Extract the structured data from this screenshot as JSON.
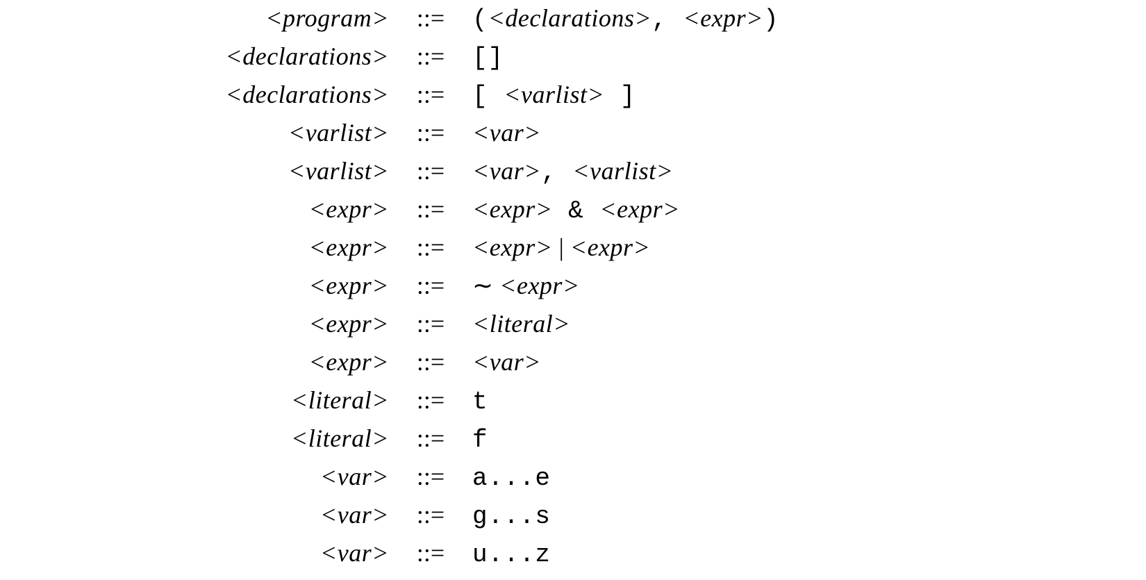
{
  "operator": "::=",
  "rules": [
    {
      "lhs": "<program>",
      "rhs": [
        {
          "type": "term",
          "text": "("
        },
        {
          "type": "nt",
          "text": "<declarations>"
        },
        {
          "type": "term",
          "text": ", "
        },
        {
          "type": "nt",
          "text": "<expr>"
        },
        {
          "type": "term",
          "text": ")"
        }
      ]
    },
    {
      "lhs": "<declarations>",
      "rhs": [
        {
          "type": "term",
          "text": "[]"
        }
      ]
    },
    {
      "lhs": "<declarations>",
      "rhs": [
        {
          "type": "term",
          "text": "[ "
        },
        {
          "type": "nt",
          "text": "<varlist>"
        },
        {
          "type": "term",
          "text": " ]"
        }
      ]
    },
    {
      "lhs": "<varlist>",
      "rhs": [
        {
          "type": "nt",
          "text": "<var>"
        }
      ]
    },
    {
      "lhs": "<varlist>",
      "rhs": [
        {
          "type": "nt",
          "text": "<var>"
        },
        {
          "type": "term",
          "text": ", "
        },
        {
          "type": "nt",
          "text": "<varlist>"
        }
      ]
    },
    {
      "lhs": "<expr>",
      "rhs": [
        {
          "type": "nt",
          "text": "<expr>"
        },
        {
          "type": "term",
          "text": " & "
        },
        {
          "type": "nt",
          "text": "<expr>"
        }
      ]
    },
    {
      "lhs": "<expr>",
      "rhs": [
        {
          "type": "nt",
          "text": "<expr>"
        },
        {
          "type": "sym",
          "text": " | "
        },
        {
          "type": "nt",
          "text": "<expr>"
        }
      ]
    },
    {
      "lhs": "<expr>",
      "rhs": [
        {
          "type": "sym",
          "text": "∼ "
        },
        {
          "type": "nt",
          "text": "<expr>"
        }
      ]
    },
    {
      "lhs": "<expr>",
      "rhs": [
        {
          "type": "nt",
          "text": "<literal>"
        }
      ]
    },
    {
      "lhs": "<expr>",
      "rhs": [
        {
          "type": "nt",
          "text": "<var>"
        }
      ]
    },
    {
      "lhs": "<literal>",
      "rhs": [
        {
          "type": "term",
          "text": "t"
        }
      ]
    },
    {
      "lhs": "<literal>",
      "rhs": [
        {
          "type": "term",
          "text": "f"
        }
      ]
    },
    {
      "lhs": "<var>",
      "rhs": [
        {
          "type": "term",
          "text": "a...e"
        }
      ]
    },
    {
      "lhs": "<var>",
      "rhs": [
        {
          "type": "term",
          "text": "g...s"
        }
      ]
    },
    {
      "lhs": "<var>",
      "rhs": [
        {
          "type": "term",
          "text": "u...z"
        }
      ]
    }
  ]
}
